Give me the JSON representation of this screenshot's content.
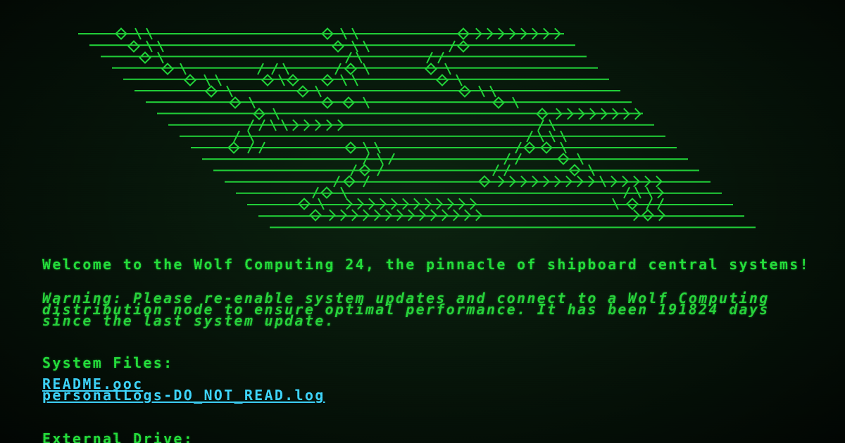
{
  "welcome_text": "Welcome to the Wolf Computing 24, the pinnacle of shipboard central systems!",
  "warning_text": "Warning: Please re-enable system updates and connect to a Wolf Computing distribution node to ensure optimal performance. It has been 191824 days since the last system update.",
  "system_files": {
    "title": "System Files:",
    "files": [
      {
        "label": "README.ooc"
      },
      {
        "label": "personalLogs-DO_NOT_READ.log"
      }
    ]
  },
  "external_drive": {
    "title": "External Drive:"
  },
  "colors": {
    "text": "#25e23c",
    "link": "#3fd8ff",
    "background": "#061409"
  },
  "logo": {
    "icon": "wolf-computing-ascii-logo"
  }
}
